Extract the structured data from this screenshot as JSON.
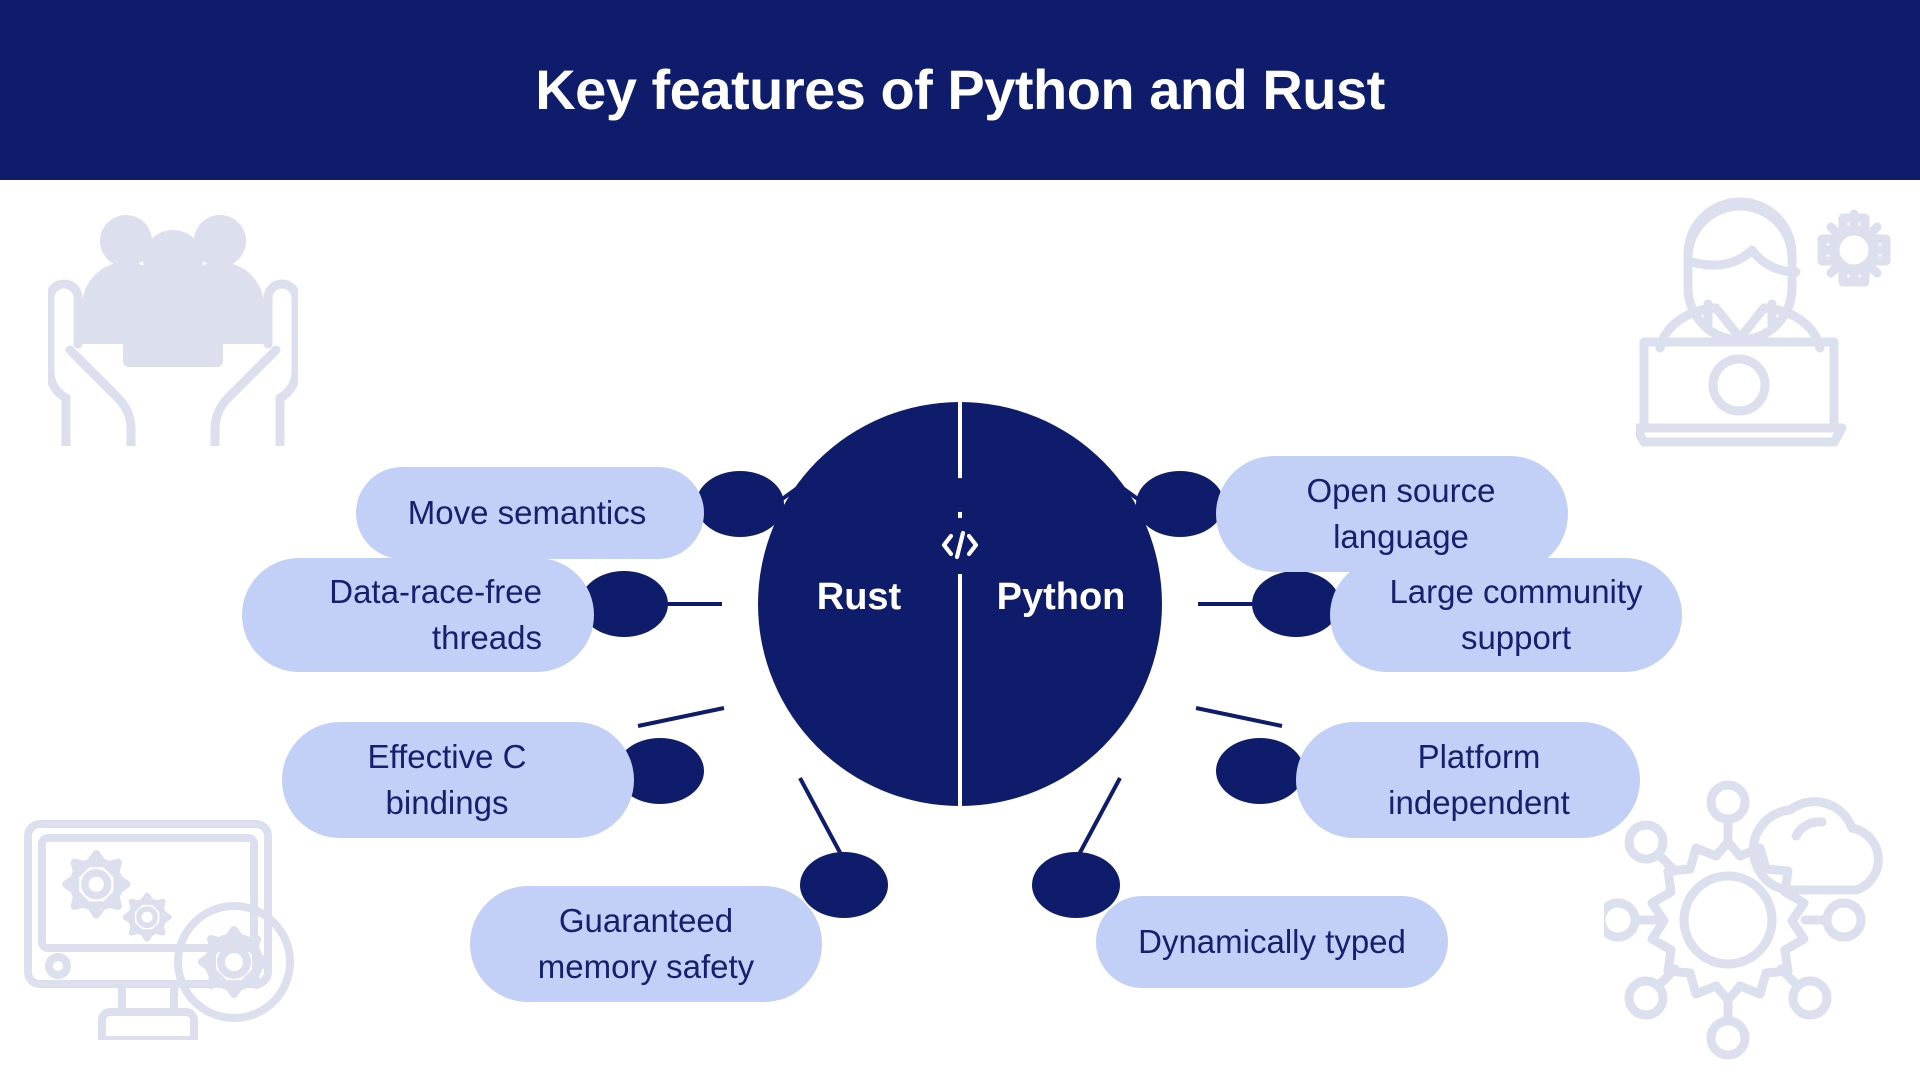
{
  "header": {
    "title": "Key features of Python and Rust",
    "background_color": "#0f1c6b",
    "text_color": "#ffffff"
  },
  "theme": {
    "navy": "#0f1c6b",
    "pill_background": "#c2d0f7",
    "pill_text": "#15216e",
    "watermark": "#dcdfee",
    "page_background": "#ffffff"
  },
  "center": {
    "left_label": "Rust",
    "right_label": "Python",
    "person_icon": "developer-code-icon",
    "code_glyph": "</>"
  },
  "watermarks": [
    {
      "name": "community-hands-icon",
      "position": "top-left"
    },
    {
      "name": "developer-laptop-gear-icon",
      "position": "top-right"
    },
    {
      "name": "monitor-gears-icon",
      "position": "bottom-left"
    },
    {
      "name": "cloud-gear-network-icon",
      "position": "bottom-right"
    }
  ],
  "features": {
    "rust": [
      {
        "id": "move-semantics",
        "lines": [
          "Move semantics"
        ]
      },
      {
        "id": "data-race-free",
        "lines": [
          "Data-race-free",
          "threads"
        ]
      },
      {
        "id": "effective-c-bindings",
        "lines": [
          "Effective C",
          "bindings"
        ]
      },
      {
        "id": "memory-safety",
        "lines": [
          "Guaranteed",
          "memory safety"
        ]
      }
    ],
    "python": [
      {
        "id": "open-source",
        "lines": [
          "Open source",
          "language"
        ]
      },
      {
        "id": "community-support",
        "lines": [
          "Large community",
          "support"
        ]
      },
      {
        "id": "platform-independent",
        "lines": [
          "Platform",
          "independent"
        ]
      },
      {
        "id": "dynamically-typed",
        "lines": [
          "Dynamically typed"
        ]
      }
    ]
  }
}
